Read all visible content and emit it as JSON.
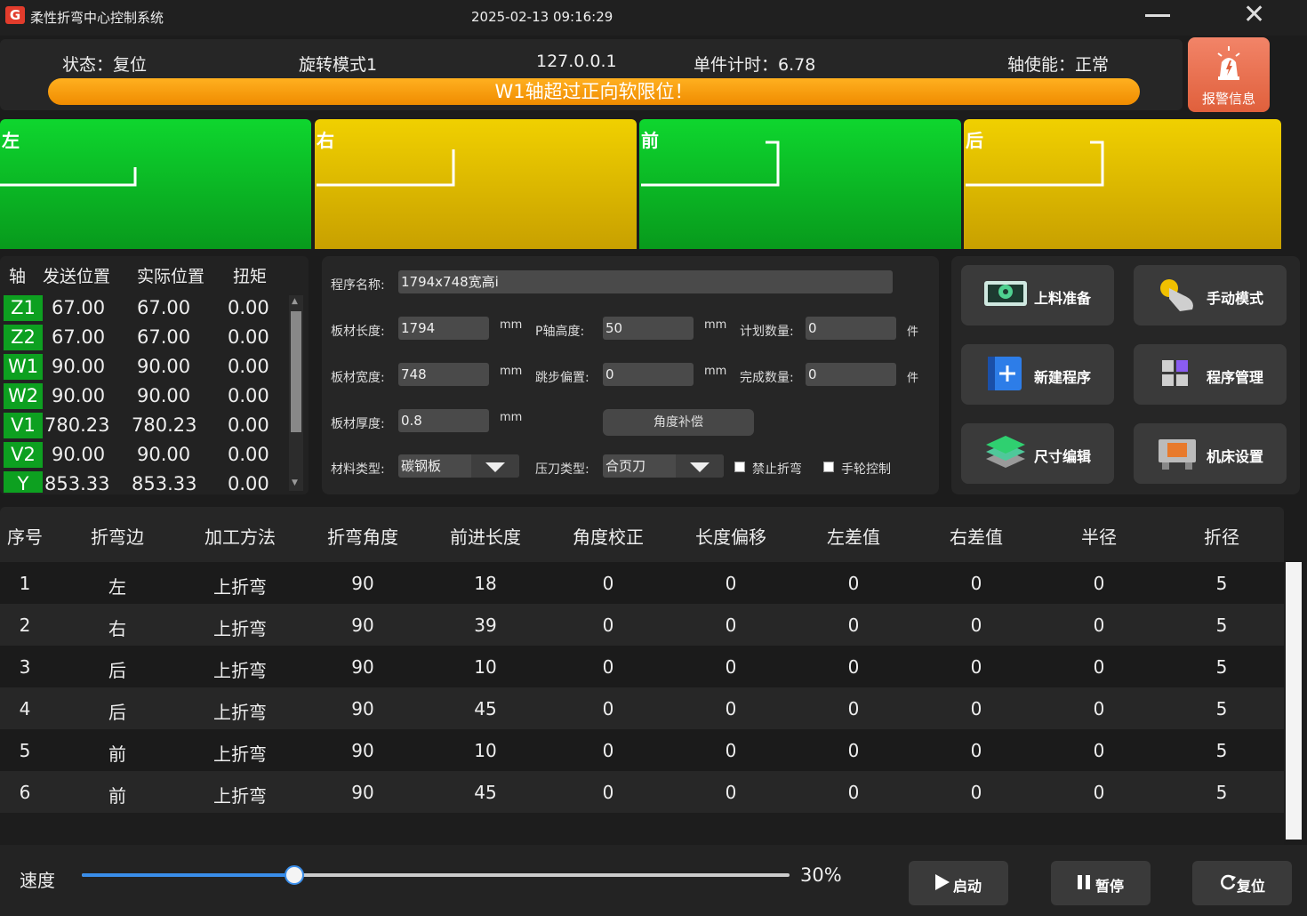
{
  "window": {
    "logo": "G",
    "title": "柔性折弯中心控制系统",
    "datetime": "2025-02-13 09:16:29"
  },
  "status": {
    "state": "状态：复位",
    "mode": "旋转模式1",
    "ip": "127.0.0.1",
    "piece_time": "单件计时：6.78",
    "axis_enable": "轴使能：正常",
    "alarm_message": "W1轴超过正向软限位！",
    "alarm_button": "报警信息"
  },
  "directions": [
    {
      "label": "左",
      "color": "green"
    },
    {
      "label": "右",
      "color": "yellow"
    },
    {
      "label": "前",
      "color": "green"
    },
    {
      "label": "后",
      "color": "yellow"
    }
  ],
  "axes": {
    "headers": [
      "轴",
      "发送位置",
      "实际位置",
      "扭矩"
    ],
    "rows": [
      {
        "name": "Z1",
        "send": "67.00",
        "actual": "67.00",
        "torque": "0.00"
      },
      {
        "name": "Z2",
        "send": "67.00",
        "actual": "67.00",
        "torque": "0.00"
      },
      {
        "name": "W1",
        "send": "90.00",
        "actual": "90.00",
        "torque": "0.00"
      },
      {
        "name": "W2",
        "send": "90.00",
        "actual": "90.00",
        "torque": "0.00"
      },
      {
        "name": "V1",
        "send": "780.23",
        "actual": "780.23",
        "torque": "0.00"
      },
      {
        "name": "V2",
        "send": "90.00",
        "actual": "90.00",
        "torque": "0.00"
      },
      {
        "name": "Y",
        "send": "853.33",
        "actual": "853.33",
        "torque": "0.00"
      }
    ]
  },
  "program": {
    "name_label": "程序名称:",
    "name_value": "1794x748宽高i",
    "length_label": "板材长度:",
    "length_value": "1794",
    "width_label": "板材宽度:",
    "width_value": "748",
    "thickness_label": "板材厚度:",
    "thickness_value": "0.8",
    "p_height_label": "P轴高度:",
    "p_height_value": "50",
    "step_offset_label": "跳步偏置:",
    "step_offset_value": "0",
    "plan_qty_label": "计划数量:",
    "plan_qty_value": "0",
    "done_qty_label": "完成数量:",
    "done_qty_value": "0",
    "unit_mm": "mm",
    "unit_piece": "件",
    "angle_comp_button": "角度补偿",
    "material_label": "材料类型:",
    "material_value": "碳钢板",
    "blade_label": "压刀类型:",
    "blade_value": "合页刀",
    "forbid_bend_label": "禁止折弯",
    "handwheel_label": "手轮控制"
  },
  "functions": [
    {
      "label": "上料准备",
      "icon": "camera-icon"
    },
    {
      "label": "手动模式",
      "icon": "hand-pointer-icon"
    },
    {
      "label": "新建程序",
      "icon": "new-program-icon"
    },
    {
      "label": "程序管理",
      "icon": "program-manage-icon"
    },
    {
      "label": "尺寸编辑",
      "icon": "layers-icon"
    },
    {
      "label": "机床设置",
      "icon": "machine-settings-icon"
    }
  ],
  "bend_table": {
    "headers": [
      "序号",
      "折弯边",
      "加工方法",
      "折弯角度",
      "前进长度",
      "角度校正",
      "长度偏移",
      "左差值",
      "右差值",
      "半径",
      "折径"
    ],
    "rows": [
      [
        "1",
        "左",
        "上折弯",
        "90",
        "18",
        "0",
        "0",
        "0",
        "0",
        "0",
        "5"
      ],
      [
        "2",
        "右",
        "上折弯",
        "90",
        "39",
        "0",
        "0",
        "0",
        "0",
        "0",
        "5"
      ],
      [
        "3",
        "后",
        "上折弯",
        "90",
        "10",
        "0",
        "0",
        "0",
        "0",
        "0",
        "5"
      ],
      [
        "4",
        "后",
        "上折弯",
        "90",
        "45",
        "0",
        "0",
        "0",
        "0",
        "0",
        "5"
      ],
      [
        "5",
        "前",
        "上折弯",
        "90",
        "10",
        "0",
        "0",
        "0",
        "0",
        "0",
        "5"
      ],
      [
        "6",
        "前",
        "上折弯",
        "90",
        "45",
        "0",
        "0",
        "0",
        "0",
        "0",
        "5"
      ]
    ]
  },
  "controls": {
    "speed_label": "速度",
    "speed_value": "30%",
    "speed_fraction": 0.3,
    "start": "启动",
    "pause": "暂停",
    "reset": "复位"
  },
  "colors": {
    "accent_blue": "#3a8eea",
    "axis_green": "#0da020",
    "alarm_orange": "#f5a000",
    "panel_green": "#0ed62e",
    "panel_yellow": "#f0d000"
  }
}
